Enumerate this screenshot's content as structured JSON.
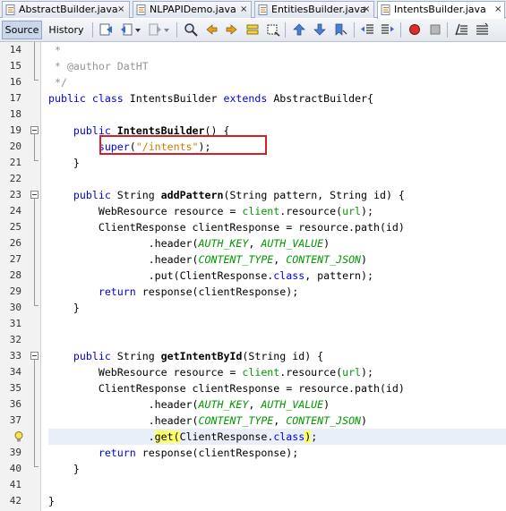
{
  "tabs": [
    {
      "label": "AbstractBuilder.java",
      "active": false
    },
    {
      "label": "NLPAPIDemo.java",
      "active": false
    },
    {
      "label": "EntitiesBuilder.java",
      "active": false
    },
    {
      "label": "IntentsBuilder.java",
      "active": true
    }
  ],
  "tab_close_glyph": "×",
  "toolbar": {
    "source_label": "Source",
    "history_label": "History",
    "icons": [
      "last-edit-icon",
      "back-icon",
      "forward-icon",
      "find-icon",
      "find-previous-icon",
      "find-next-icon",
      "toggle-highlight-icon",
      "find-selection-icon",
      "previous-bookmark-icon",
      "next-bookmark-icon",
      "toggle-bookmark-icon",
      "shift-left-icon",
      "shift-right-icon",
      "start-macro-icon",
      "stop-macro-icon",
      "comment-icon",
      "uncomment-icon"
    ]
  },
  "colors": {
    "keyword": "#0000e6",
    "comment": "#969696",
    "string": "#ce7b00",
    "field": "#009900",
    "annotation_box": "#d61f26",
    "brace_match": "#ffff66"
  },
  "code": {
    "lines": [
      {
        "n": "14",
        "text": " *"
      },
      {
        "n": "15",
        "text": " * @author DatHT"
      },
      {
        "n": "16",
        "text": " */"
      },
      {
        "n": "17",
        "text": "public class IntentsBuilder extends AbstractBuilder{"
      },
      {
        "n": "18",
        "text": ""
      },
      {
        "n": "19",
        "text": "    public IntentsBuilder() {"
      },
      {
        "n": "20",
        "text": "        super(\"/intents\");"
      },
      {
        "n": "21",
        "text": "    }"
      },
      {
        "n": "22",
        "text": ""
      },
      {
        "n": "23",
        "text": "    public String addPattern(String pattern, String id) {"
      },
      {
        "n": "24",
        "text": "        WebResource resource = client.resource(url);"
      },
      {
        "n": "25",
        "text": "        ClientResponse clientResponse = resource.path(id)"
      },
      {
        "n": "26",
        "text": "                .header(AUTH_KEY, AUTH_VALUE)"
      },
      {
        "n": "27",
        "text": "                .header(CONTENT_TYPE, CONTENT_JSON)"
      },
      {
        "n": "28",
        "text": "                .put(ClientResponse.class, pattern);"
      },
      {
        "n": "29",
        "text": "        return response(clientResponse);"
      },
      {
        "n": "30",
        "text": "    }"
      },
      {
        "n": "31",
        "text": ""
      },
      {
        "n": "32",
        "text": ""
      },
      {
        "n": "33",
        "text": "    public String getIntentById(String id) {"
      },
      {
        "n": "34",
        "text": "        WebResource resource = client.resource(url);"
      },
      {
        "n": "35",
        "text": "        ClientResponse clientResponse = resource.path(id)"
      },
      {
        "n": "36",
        "text": "                .header(AUTH_KEY, AUTH_VALUE)"
      },
      {
        "n": "37",
        "text": "                .header(CONTENT_TYPE, CONTENT_JSON)"
      },
      {
        "n": "38",
        "text": "                .get(ClientResponse.class);"
      },
      {
        "n": "39",
        "text": "        return response(clientResponse);"
      },
      {
        "n": "40",
        "text": "    }"
      },
      {
        "n": "41",
        "text": ""
      },
      {
        "n": "42",
        "text": "}"
      }
    ]
  }
}
